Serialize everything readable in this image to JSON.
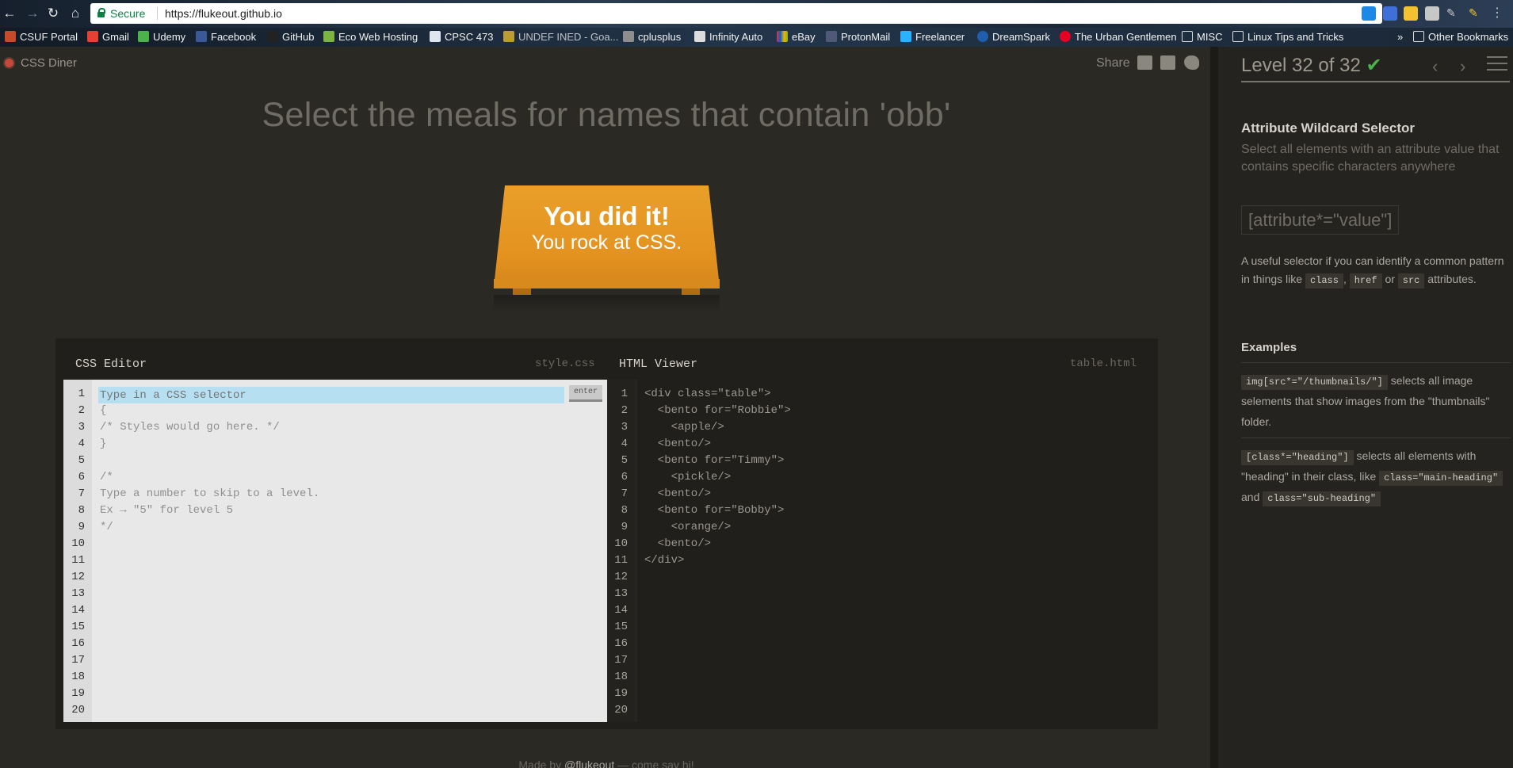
{
  "browser": {
    "secure_label": "Secure",
    "url": "https://flukeout.github.io",
    "bookmarks": [
      "CSUF Portal",
      "Gmail",
      "Udemy",
      "Facebook",
      "GitHub",
      "Eco Web Hosting",
      "CPSC 473",
      "UNDEF INED - Goa...",
      "cplusplus",
      "Infinity Auto",
      "eBay",
      "ProtonMail",
      "Freelancer",
      "DreamSpark",
      "The Urban Gentlemen",
      "MISC",
      "Linux Tips and Tricks"
    ],
    "other_bookmarks": "Other Bookmarks",
    "overflow": "»"
  },
  "app": {
    "logo": "CSS Diner",
    "share_label": "Share",
    "instruction": "Select the meals for names that contain 'obb'",
    "win_title": "You did it!",
    "win_subtitle": "You rock at CSS.",
    "footer_prefix": "Made by",
    "footer_link": "@flukeout",
    "footer_suffix": "— come say hi!"
  },
  "css_editor": {
    "title": "CSS Editor",
    "file": "style.css",
    "placeholder": "Type in a CSS selector",
    "enter_label": "enter",
    "lines": [
      "",
      "{",
      "/* Styles would go here. */",
      "}",
      "",
      "/*",
      "Type a number to skip to a level.",
      "Ex → \"5\" for level 5",
      "*/"
    ],
    "line_count": 20
  },
  "html_viewer": {
    "title": "HTML Viewer",
    "file": "table.html",
    "lines": [
      "<div class=\"table\">",
      "  <bento for=\"Robbie\">",
      "    <apple/>",
      "  <bento/>",
      "  <bento for=\"Timmy\">",
      "    <pickle/>",
      "  <bento/>",
      "  <bento for=\"Bobby\">",
      "    <orange/>",
      "  <bento/>",
      "</div>"
    ],
    "line_count": 20
  },
  "sidebar": {
    "level_label": "Level 32 of 32",
    "check": "✔",
    "prev": "‹",
    "next": "›",
    "progress": 1.0,
    "selector_name": "Attribute Wildcard Selector",
    "selector_title": "Select all elements with an attribute value that contains specific characters anywhere",
    "syntax": "[attribute*=\"value\"]",
    "hint_text_1": "A useful selector if you can identify a common pattern in things like",
    "hint_chip_1": "class",
    "hint_sep_1": ",",
    "hint_chip_2": "href",
    "hint_sep_2": "or",
    "hint_chip_3": "src",
    "hint_text_2": "attributes.",
    "examples_heading": "Examples",
    "example_1_code": "img[src*=\"/thumbnails/\"]",
    "example_1_text": "selects all image selements that show images from the \"thumbnails\" folder.",
    "example_2_code": "[class*=\"heading\"]",
    "example_2_text_1": "selects all elements with \"heading\" in their class, like",
    "example_2_chip_1": "class=\"main-heading\"",
    "example_2_and": "and",
    "example_2_chip_2": "class=\"sub-heading\""
  },
  "colors": {
    "accent_orange": "#e3921f",
    "success_green": "#4cb34c",
    "editor_highlight": "#b6dff2"
  }
}
